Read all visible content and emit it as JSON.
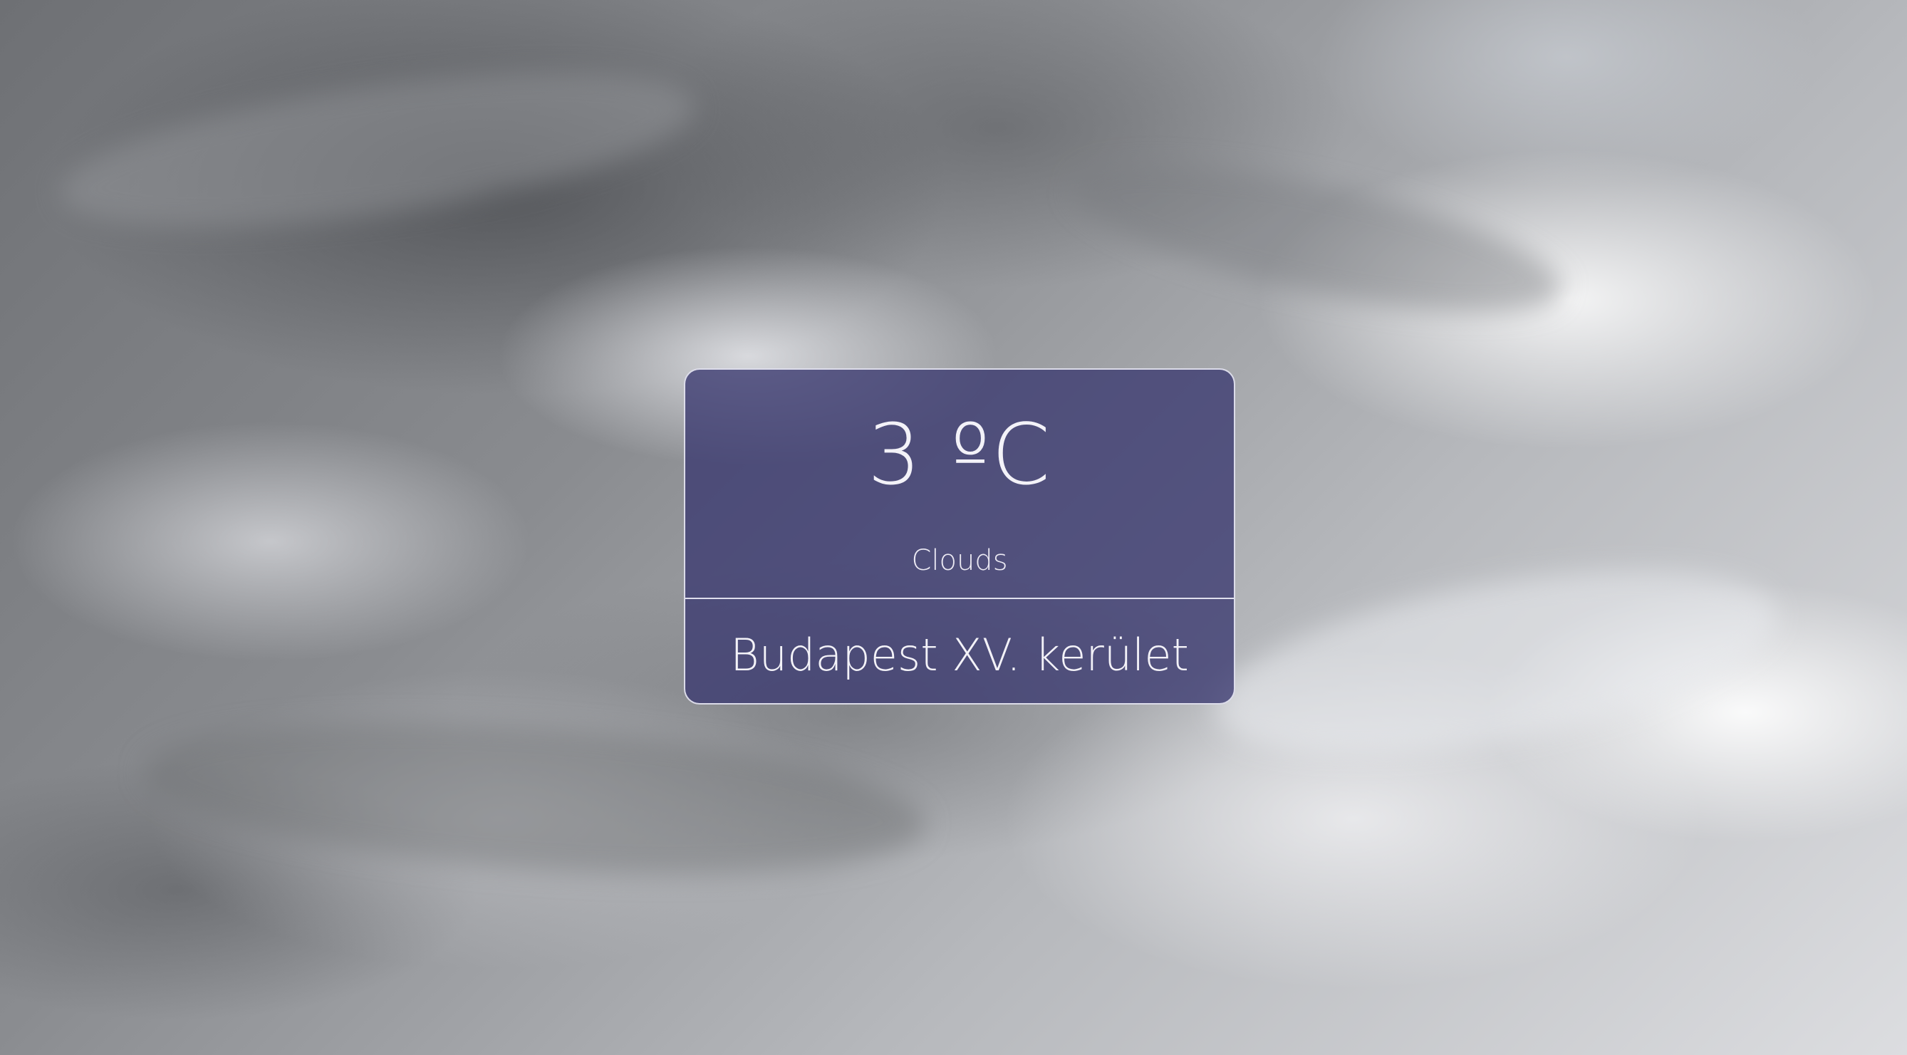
{
  "weather": {
    "temperature": "3 ºC",
    "condition": "Clouds",
    "location": "Budapest XV. kerület"
  },
  "colors": {
    "card_background": "#3a3870",
    "card_border": "#ebebf5",
    "text": "#f3f2f8"
  }
}
